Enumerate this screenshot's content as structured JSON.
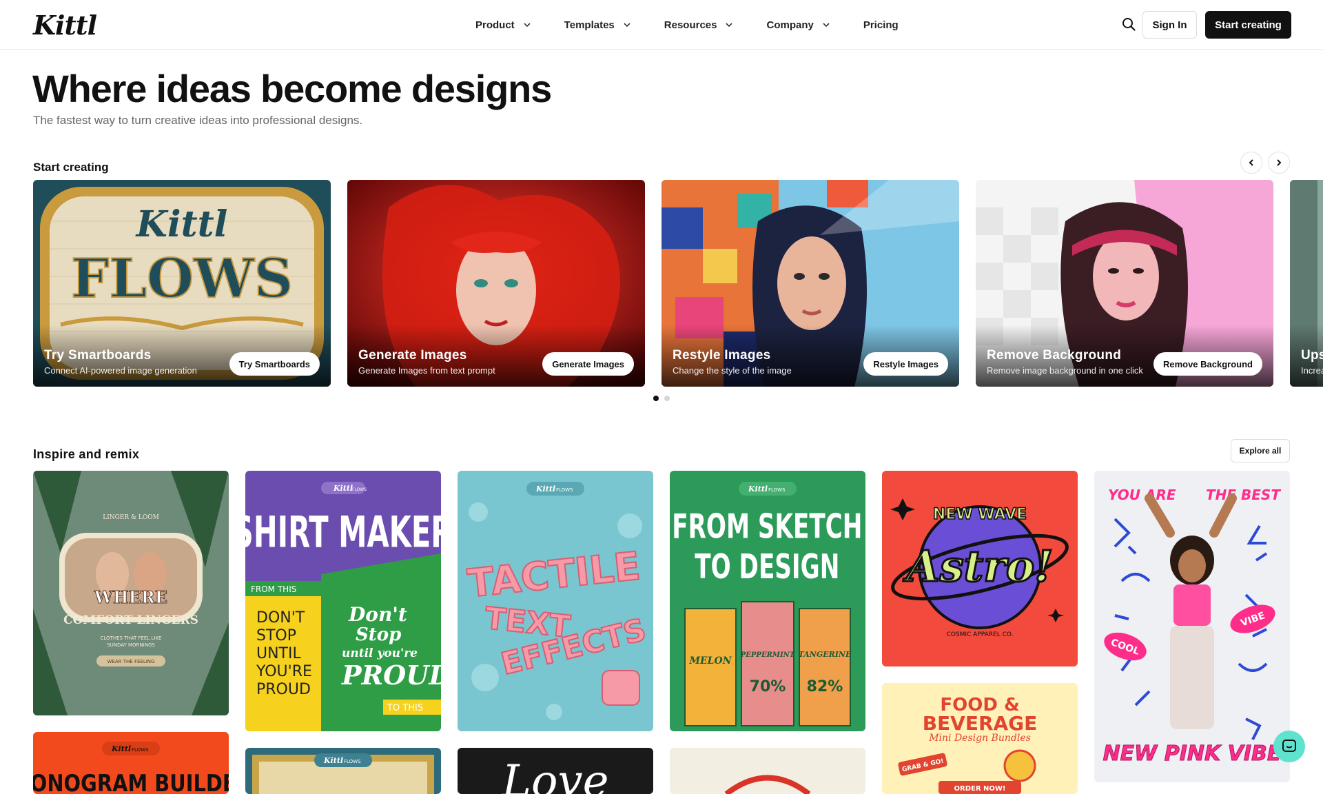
{
  "header": {
    "logo": "Kittl",
    "nav": [
      "Product",
      "Templates",
      "Resources",
      "Company",
      "Pricing"
    ],
    "sign_in": "Sign In",
    "start_creating": "Start creating"
  },
  "hero": {
    "title": "Where ideas become designs",
    "subtitle": "The fastest way to turn creative ideas into professional designs."
  },
  "start_section": {
    "label": "Start creating",
    "cards": [
      {
        "title": "Try Smartboards",
        "desc": "Connect AI-powered image generation",
        "button": "Try Smartboards"
      },
      {
        "title": "Generate Images",
        "desc": "Generate Images from text prompt",
        "button": "Generate Images"
      },
      {
        "title": "Restyle Images",
        "desc": "Change the style of the image",
        "button": "Restyle Images"
      },
      {
        "title": "Remove Background",
        "desc": "Remove image background in one click",
        "button": "Remove Background"
      },
      {
        "title": "Ups",
        "desc": "Increa"
      }
    ],
    "active_dot": 0
  },
  "inspire": {
    "label": "Inspire and remix",
    "explore": "Explore all",
    "tiles": {
      "t1": {
        "brand": "LINGER & LOOM",
        "line1": "WHERE",
        "line2": "COMFORT LINGERS",
        "line3": "CLOTHES THAT FEEL LIKE",
        "line4": "SUNDAY MORNINGS",
        "tag": "WEAR THE FEELING"
      },
      "t2": {
        "brand": "Kittl",
        "flows": "FLOWS",
        "title": "SHIRT MAKER",
        "from": "FROM THIS",
        "left": [
          "DON'T",
          "STOP",
          "UNTIL",
          "YOU'RE",
          "PROUD"
        ],
        "right": [
          "Don't",
          "Stop",
          "until you're",
          "PROUD"
        ],
        "to": "TO THIS"
      },
      "t3": {
        "brand": "Kittl",
        "flows": "FLOWS",
        "l1": "TACTILE",
        "l2": "TEXT",
        "l3": "EFFECTS"
      },
      "t4": {
        "brand": "Kittl",
        "flows": "FLOWS",
        "l1": "FROM SKETCH",
        "l2": "TO DESIGN",
        "p1": "MELON",
        "p2": "PEPPERMINT",
        "p3": "TANGERINE",
        "pct1": "70%",
        "pct2": "82%"
      },
      "t5": {
        "l1": "NEW WAVE",
        "l2": "Astro!",
        "l3": "COSMIC APPAREL CO."
      },
      "t6": {
        "l1": "YOU ARE",
        "l2": "THE BEST",
        "l3": "VIBE",
        "l4": "COOL",
        "l5": "NEW PINK VIBE"
      },
      "t7": {
        "brand": "Kittl",
        "flows": "FLOWS",
        "title": "MONOGRAM BUILDER"
      },
      "t8": {
        "brand": "Kittl",
        "flows": "FLOWS"
      },
      "t9": {
        "l1": "Love"
      },
      "t11": {
        "l1": "FOOD &",
        "l2": "BEVERAGE",
        "l3": "Mini Design Bundles",
        "l4": "GRAB & GO!",
        "l5": "ORDER NOW!"
      }
    }
  },
  "colors": {
    "brand_dark": "#111111",
    "chat": "#5fe3cf",
    "astro_bg": "#f24a3c",
    "pink": "#ff2d8a"
  }
}
